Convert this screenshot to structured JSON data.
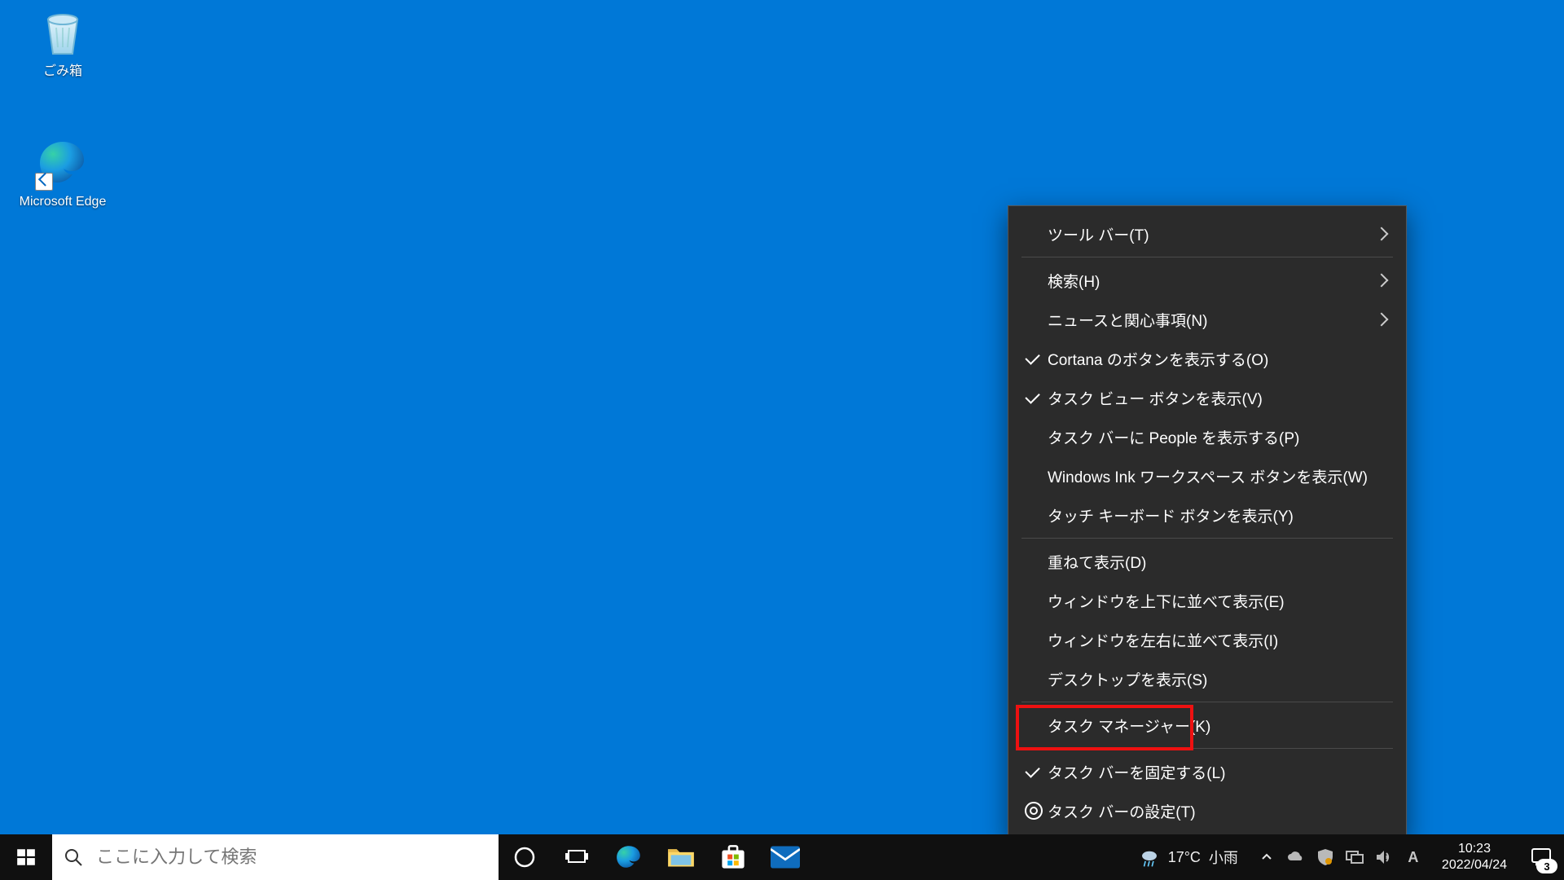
{
  "desktop": {
    "icons": [
      {
        "name": "recycle-bin",
        "label": "ごみ箱"
      },
      {
        "name": "microsoft-edge",
        "label": "Microsoft Edge"
      }
    ]
  },
  "taskbar": {
    "search_placeholder": "ここに入力して検索",
    "weather": {
      "temp": "17°C",
      "cond": "小雨"
    },
    "clock": {
      "time": "10:23",
      "date": "2022/04/24"
    },
    "action_center_count": "3"
  },
  "context_menu": {
    "items": [
      {
        "label": "ツール バー(T)",
        "submenu": true
      },
      {
        "sep": true
      },
      {
        "label": "検索(H)",
        "submenu": true
      },
      {
        "label": "ニュースと関心事項(N)",
        "submenu": true
      },
      {
        "label": "Cortana のボタンを表示する(O)",
        "checked": true
      },
      {
        "label": "タスク ビュー ボタンを表示(V)",
        "checked": true
      },
      {
        "label": "タスク バーに People を表示する(P)"
      },
      {
        "label": "Windows Ink ワークスペース ボタンを表示(W)"
      },
      {
        "label": "タッチ キーボード ボタンを表示(Y)"
      },
      {
        "sep": true
      },
      {
        "label": "重ねて表示(D)"
      },
      {
        "label": "ウィンドウを上下に並べて表示(E)"
      },
      {
        "label": "ウィンドウを左右に並べて表示(I)"
      },
      {
        "label": "デスクトップを表示(S)"
      },
      {
        "sep": true
      },
      {
        "label": "タスク マネージャー(K)",
        "highlighted": true
      },
      {
        "sep": true
      },
      {
        "label": "タスク バーを固定する(L)",
        "checked": true
      },
      {
        "label": "タスク バーの設定(T)",
        "icon": "gear"
      }
    ]
  }
}
